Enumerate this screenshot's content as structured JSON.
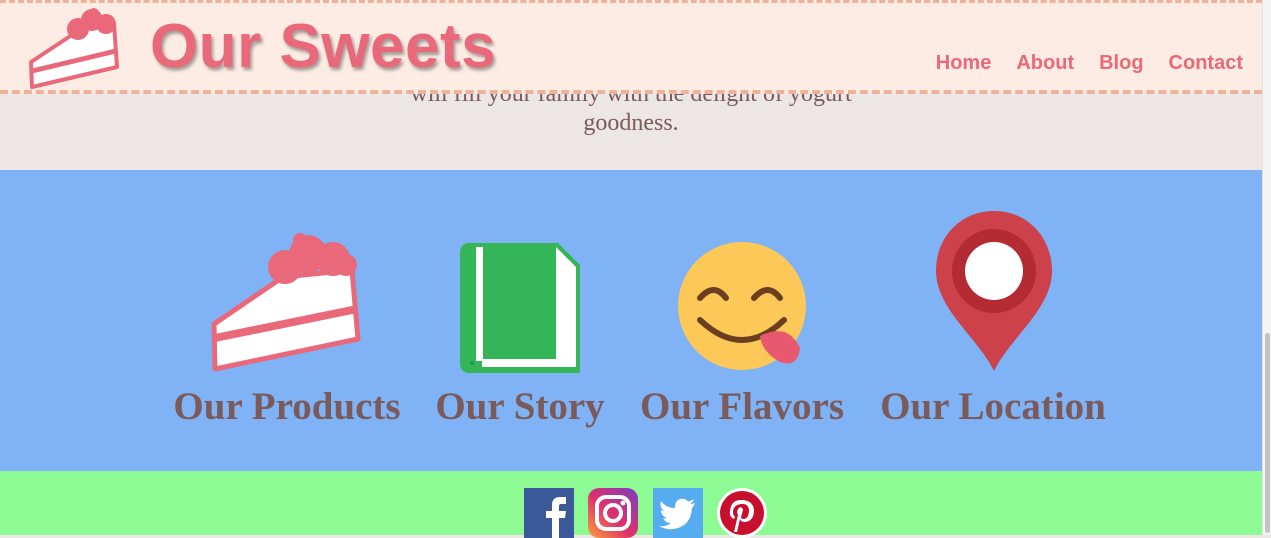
{
  "header": {
    "title": "Our Sweets",
    "logo_icon": "cake-slice-icon",
    "nav": [
      "Home",
      "About",
      "Blog",
      "Contact"
    ]
  },
  "intro": {
    "lines": [
      "will fill your family with the delight of yogurt",
      "goodness."
    ]
  },
  "features": [
    {
      "label": "Our Products",
      "icon": "cake-slice-icon"
    },
    {
      "label": "Our Story",
      "icon": "book-icon"
    },
    {
      "label": "Our Flavors",
      "icon": "tongue-smiley-icon"
    },
    {
      "label": "Our Location",
      "icon": "map-pin-icon"
    }
  ],
  "social": [
    "facebook-icon",
    "instagram-icon",
    "twitter-icon",
    "pinterest-icon"
  ],
  "colors": {
    "header_bg": "#fcece3",
    "brand_pink": "#e9697b",
    "features_bg": "#7fb3f5",
    "social_bg": "#8efa93",
    "text_brown": "#7a5a5a"
  }
}
